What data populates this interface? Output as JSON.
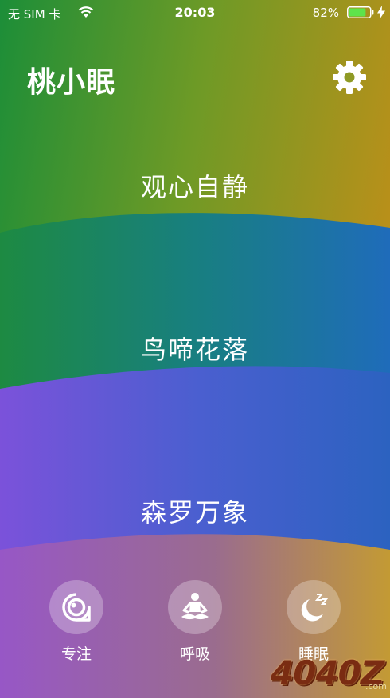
{
  "status_bar": {
    "carrier": "无 SIM 卡",
    "time": "20:03",
    "battery_percent": "82%",
    "battery_level": 0.82
  },
  "header": {
    "title": "桃小眠",
    "settings_icon": "gear-icon"
  },
  "modes": [
    {
      "label": "观心自静"
    },
    {
      "label": "鸟啼花落"
    },
    {
      "label": "森罗万象"
    }
  ],
  "bottom_nav": [
    {
      "label": "专注",
      "icon": "focus-eye-icon"
    },
    {
      "label": "呼吸",
      "icon": "meditation-icon"
    },
    {
      "label": "睡眠",
      "icon": "moon-zzz-icon"
    }
  ],
  "watermark": {
    "text": "4040Z",
    "domain": ".com"
  },
  "colors": {
    "band1_left": "#1f8a3a",
    "band1_right": "#b5901c",
    "band2_left": "#1f8a45",
    "band2_right": "#1f6fb6",
    "band3_left": "#7a55d8",
    "band3_right": "#2f5fc0",
    "band4_left": "#9a5ac2",
    "band4_right": "#c19a36"
  }
}
